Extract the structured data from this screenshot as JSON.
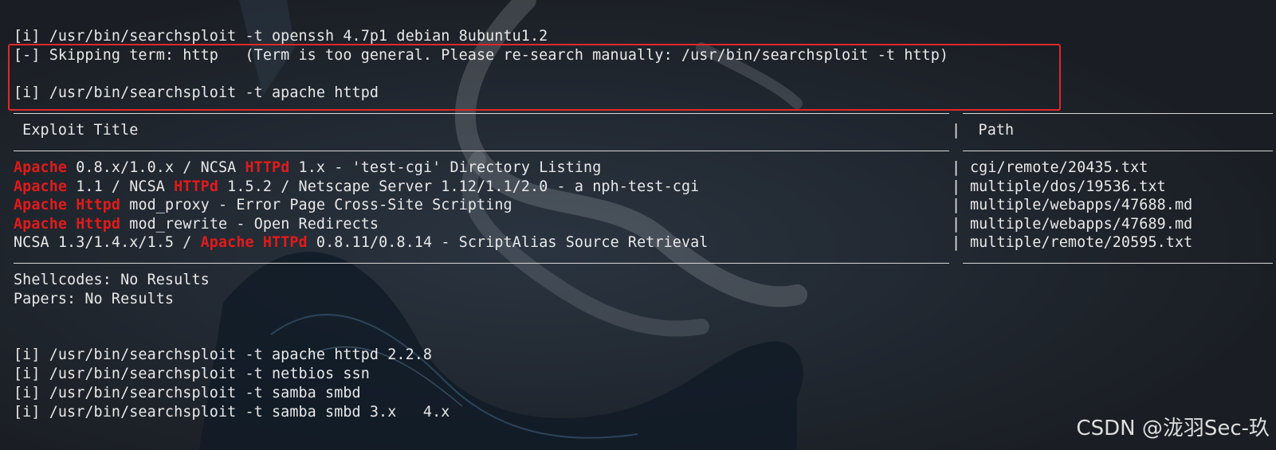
{
  "commands_top": {
    "line1": "[i] /usr/bin/searchsploit -t openssh 4.7p1 debian 8ubuntu1.2",
    "line2": "[-] Skipping term: http   (Term is too general. Please re-search manually: /usr/bin/searchsploit -t http)",
    "line3": "[i] /usr/bin/searchsploit -t apache httpd"
  },
  "table": {
    "header_title": " Exploit Title",
    "header_path": "|  Path",
    "rows": [
      {
        "parts": [
          {
            "t": "Apache",
            "hl": true
          },
          {
            "t": " 0.8.x/1.0.x / NCSA ",
            "hl": false
          },
          {
            "t": "HTTPd",
            "hl": true
          },
          {
            "t": " 1.x - 'test-cgi' Directory Listing",
            "hl": false
          }
        ],
        "path": "cgi/remote/20435.txt"
      },
      {
        "parts": [
          {
            "t": "Apache",
            "hl": true
          },
          {
            "t": " 1.1 / NCSA ",
            "hl": false
          },
          {
            "t": "HTTPd",
            "hl": true
          },
          {
            "t": " 1.5.2 / Netscape Server 1.12/1.1/2.0 - a nph-test-cgi",
            "hl": false
          }
        ],
        "path": "multiple/dos/19536.txt"
      },
      {
        "parts": [
          {
            "t": "Apache",
            "hl": true
          },
          {
            "t": " ",
            "hl": false
          },
          {
            "t": "Httpd",
            "hl": true
          },
          {
            "t": " mod_proxy - Error Page Cross-Site Scripting",
            "hl": false
          }
        ],
        "path": "multiple/webapps/47688.md"
      },
      {
        "parts": [
          {
            "t": "Apache",
            "hl": true
          },
          {
            "t": " ",
            "hl": false
          },
          {
            "t": "Httpd",
            "hl": true
          },
          {
            "t": " mod_rewrite - Open Redirects",
            "hl": false
          }
        ],
        "path": "multiple/webapps/47689.md"
      },
      {
        "parts": [
          {
            "t": "NCSA 1.3/1.4.x/1.5 / ",
            "hl": false
          },
          {
            "t": "Apache",
            "hl": true
          },
          {
            "t": " ",
            "hl": false
          },
          {
            "t": "HTTPd",
            "hl": true
          },
          {
            "t": " 0.8.11/0.8.14 - ScriptAlias Source Retrieval",
            "hl": false
          }
        ],
        "path": "multiple/remote/20595.txt"
      }
    ],
    "row_separator": "|"
  },
  "results": {
    "shellcodes": "Shellcodes: No Results",
    "papers": "Papers: No Results"
  },
  "commands_bottom": [
    "[i] /usr/bin/searchsploit -t apache httpd 2.2.8",
    "[i] /usr/bin/searchsploit -t netbios ssn",
    "[i] /usr/bin/searchsploit -t samba smbd",
    "[i] /usr/bin/searchsploit -t samba smbd 3.x   4.x"
  ],
  "watermark": "CSDN @泷羽Sec-玖",
  "colors": {
    "background": "#1c2128",
    "text": "#e9e9e9",
    "highlight": "#e01b1b",
    "annotation_box": "#e0282a"
  }
}
